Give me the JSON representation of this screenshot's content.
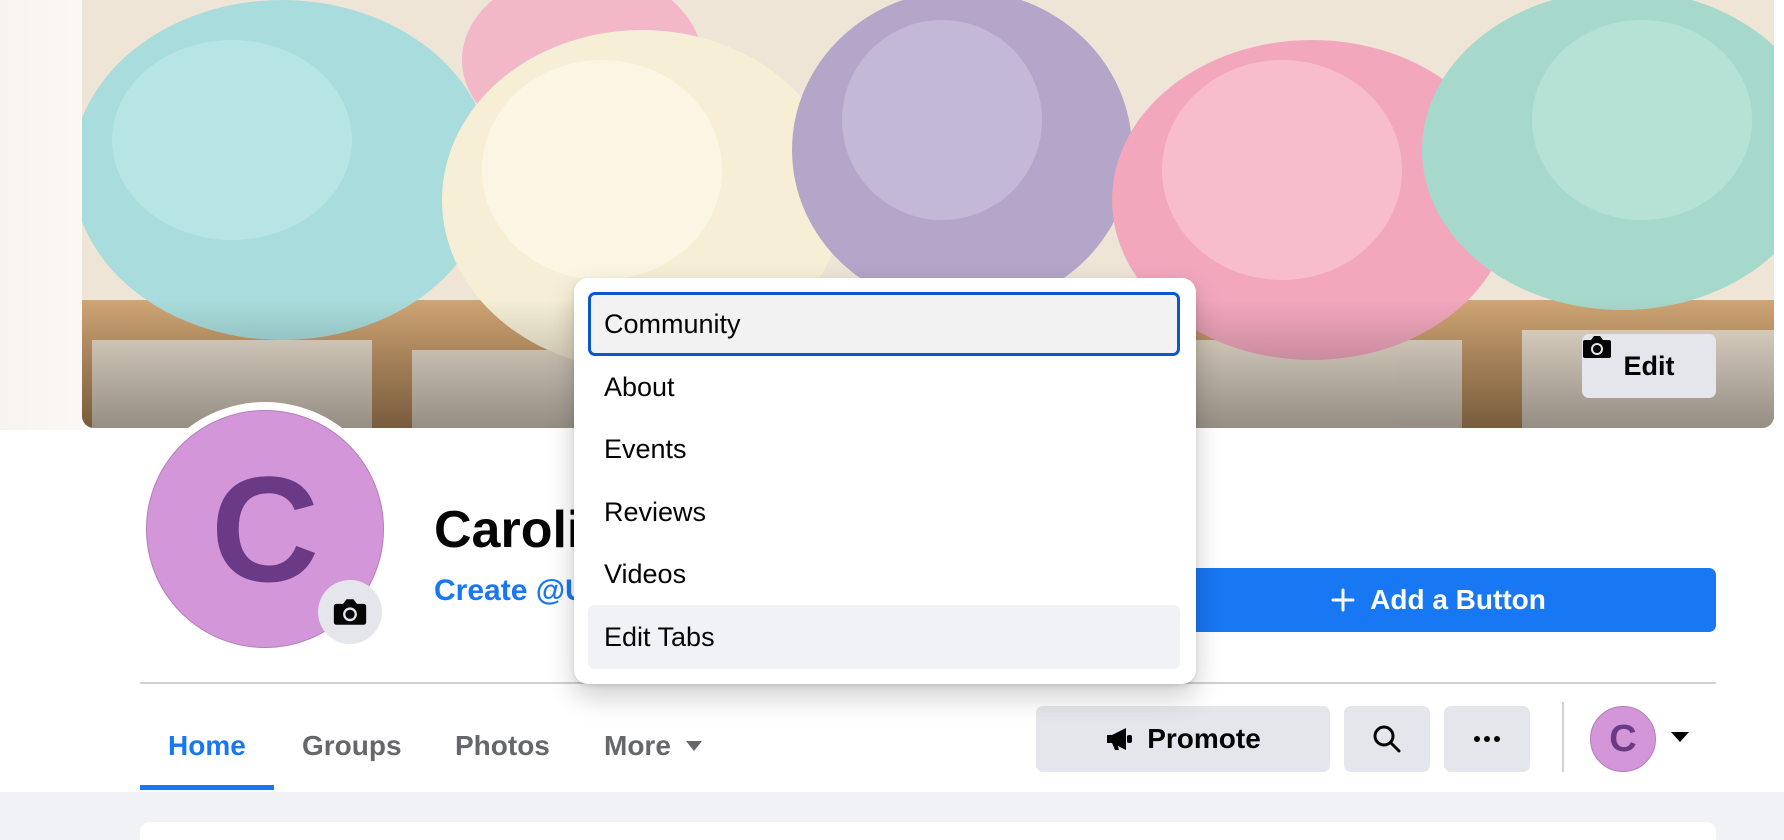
{
  "cover": {
    "edit_label": "Edit"
  },
  "profile": {
    "avatar_initial": "C",
    "page_name": "Caroli",
    "username_link": "Create @U"
  },
  "actions": {
    "add_button_label": "Add a Button",
    "promote_label": "Promote"
  },
  "tabs": [
    {
      "label": "Home",
      "active": true
    },
    {
      "label": "Groups",
      "active": false
    },
    {
      "label": "Photos",
      "active": false
    },
    {
      "label": "More",
      "active": false
    }
  ],
  "more_menu": {
    "items": [
      {
        "label": "Community",
        "state": "focused"
      },
      {
        "label": "About",
        "state": ""
      },
      {
        "label": "Events",
        "state": ""
      },
      {
        "label": "Reviews",
        "state": ""
      },
      {
        "label": "Videos",
        "state": ""
      },
      {
        "label": "Edit Tabs",
        "state": "hover"
      }
    ]
  },
  "account": {
    "avatar_initial": "C"
  },
  "icons": [
    "camera-icon",
    "plus-icon",
    "megaphone-icon",
    "search-icon",
    "more-horizontal-icon",
    "caret-down-icon"
  ],
  "colors": {
    "accent": "#1877f2",
    "button_gray": "#e4e6eb",
    "avatar_bg": "#d397d9",
    "avatar_letter": "#6b3a86",
    "focus_ring": "#0b57d0"
  }
}
